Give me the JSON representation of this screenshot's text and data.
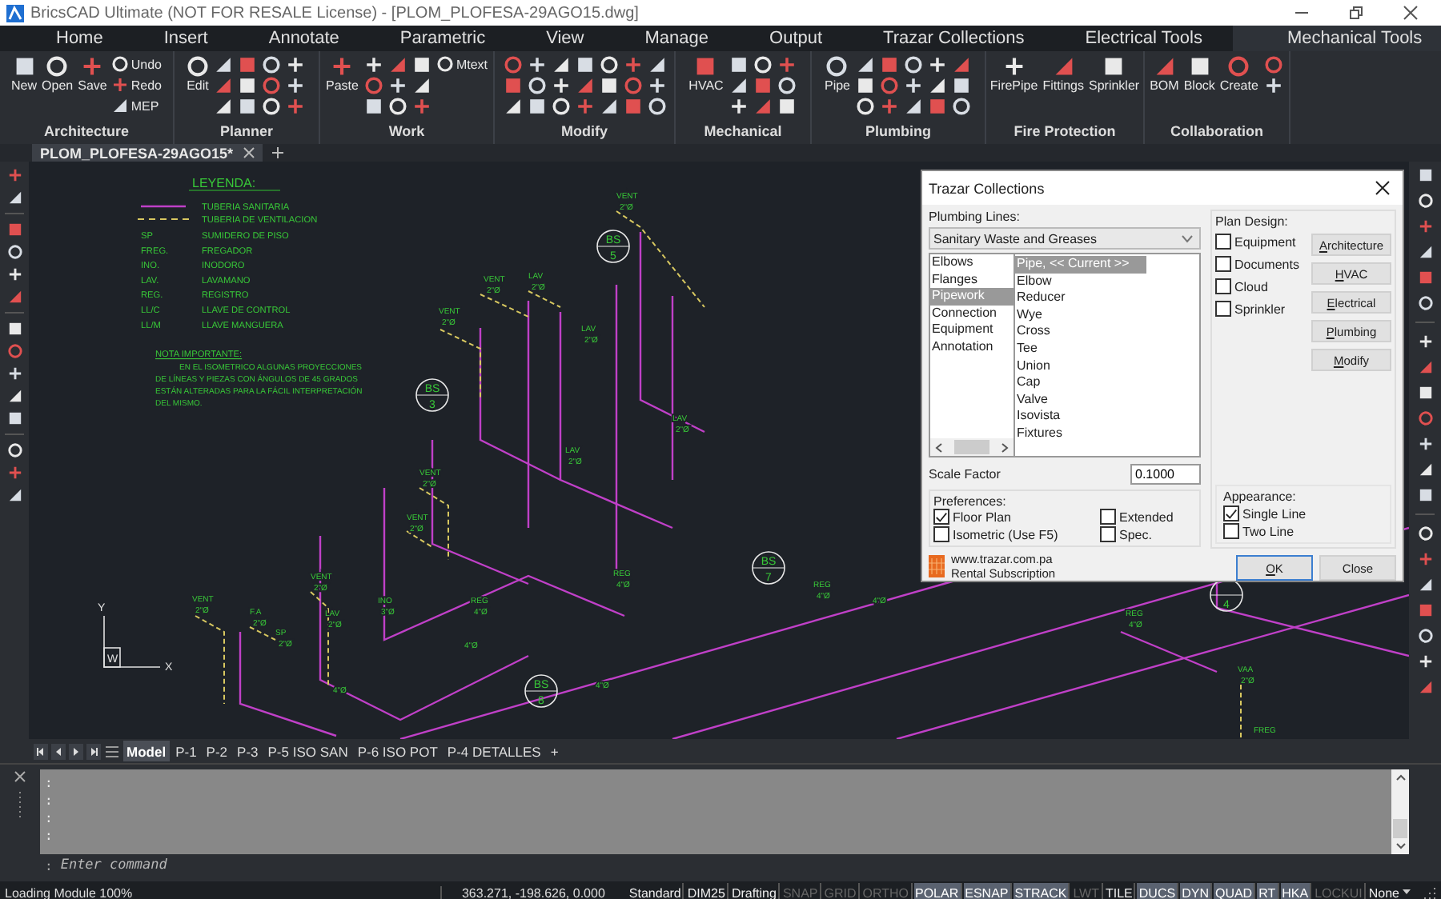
{
  "window": {
    "title": "BricsCAD Ultimate (NOT FOR RESALE License) - [PLOM_PLOFESA-29AGO15.dwg]"
  },
  "ribbon_tabs": [
    {
      "label": "Home",
      "selected": false
    },
    {
      "label": "Insert",
      "selected": false
    },
    {
      "label": "Annotate",
      "selected": false
    },
    {
      "label": "Parametric",
      "selected": false
    },
    {
      "label": "View",
      "selected": false
    },
    {
      "label": "Manage",
      "selected": false
    },
    {
      "label": "Output",
      "selected": false
    },
    {
      "label": "Trazar Collections",
      "selected": false
    },
    {
      "label": "Electrical Tools",
      "selected": false
    },
    {
      "label": "Mechanical Tools",
      "selected": true
    }
  ],
  "ribbon_panels": [
    {
      "title": "Architecture",
      "tools": [
        {
          "label": "New",
          "kind": "large"
        },
        {
          "label": "Open",
          "kind": "large"
        },
        {
          "label": "Save",
          "kind": "large"
        },
        {
          "label": "Undo",
          "kind": "small"
        },
        {
          "label": "Redo",
          "kind": "small"
        },
        {
          "label": "MEP",
          "kind": "small"
        }
      ]
    },
    {
      "title": "Planner",
      "tools": [
        {
          "label": "Edit",
          "kind": "large"
        }
      ]
    },
    {
      "title": "Work",
      "tools": [
        {
          "label": "Paste",
          "kind": "large"
        },
        {
          "label": "Mtext",
          "kind": "small"
        }
      ]
    },
    {
      "title": "Modify"
    },
    {
      "title": "Mechanical",
      "tools": [
        {
          "label": "HVAC",
          "kind": "large"
        }
      ]
    },
    {
      "title": "Plumbing",
      "tools": [
        {
          "label": "Pipe",
          "kind": "large"
        }
      ]
    },
    {
      "title": "Fire Protection",
      "tools": [
        {
          "label": "FirePipe",
          "kind": "large"
        },
        {
          "label": "Fittings",
          "kind": "large"
        },
        {
          "label": "Sprinkler",
          "kind": "large"
        }
      ]
    },
    {
      "title": "Collaboration",
      "tools": [
        {
          "label": "BOM",
          "kind": "large"
        },
        {
          "label": "Block",
          "kind": "large"
        },
        {
          "label": "Create",
          "kind": "large"
        }
      ]
    }
  ],
  "document_tab": {
    "label": "PLOM_PLOFESA-29AGO15*"
  },
  "legend": {
    "title": "LEYENDA:",
    "line_rows": [
      {
        "label": "TUBERIA SANITARIA",
        "kind": "solid"
      },
      {
        "label": "TUBERIA DE VENTILACION",
        "kind": "dashed"
      }
    ],
    "rows": [
      {
        "code": "SP",
        "label": "SUMIDERO DE PISO"
      },
      {
        "code": "FREG.",
        "label": "FREGADOR"
      },
      {
        "code": "INO.",
        "label": "INODORO"
      },
      {
        "code": "LAV.",
        "label": "LAVAMANO"
      },
      {
        "code": "REG.",
        "label": "REGISTRO"
      },
      {
        "code": "LL/C",
        "label": "LLAVE DE CONTROL"
      },
      {
        "code": "LL/M",
        "label": "LLAVE MANGUERA"
      }
    ],
    "note_title": "NOTA IMPORTANTE:",
    "note_lines": [
      "EN EL ISOMETRICO ALGUNAS PROYECCIONES",
      "DE LÍNEAS Y PIEZAS CON ÁNGULOS DE 45 GRADOS",
      "ESTÁN ALTERADAS PARA LA FÁCIL INTERPRETACIÓN",
      "DEL MISMO."
    ]
  },
  "drawing_labels": [
    {
      "text": "VENT",
      "sub": "2\"Ø"
    },
    {
      "text": "VENT",
      "sub": "2\"Ø"
    },
    {
      "text": "VENT",
      "sub": "2\"Ø"
    },
    {
      "text": "LAV",
      "sub": "2\"Ø"
    },
    {
      "text": "LAV",
      "sub": "2\"Ø"
    },
    {
      "text": "LAV",
      "sub": "2\"Ø"
    },
    {
      "text": "VENT",
      "sub": "2\"Ø"
    },
    {
      "text": "LAV",
      "sub": "2\"Ø"
    },
    {
      "text": "VENT",
      "sub": "2\"Ø"
    },
    {
      "text": "VENT",
      "sub": "2\"Ø"
    },
    {
      "text": "VENT",
      "sub": "2\"Ø"
    },
    {
      "text": "F.A",
      "sub": "2\"Ø"
    },
    {
      "text": "SP",
      "sub": "2\"Ø"
    },
    {
      "text": "LAV",
      "sub": "2\"Ø"
    },
    {
      "text": "INO",
      "sub": "3\"Ø"
    },
    {
      "text": "REG",
      "sub": "4\"Ø"
    },
    {
      "text": "REG",
      "sub": "4\"Ø"
    },
    {
      "text": "REG",
      "sub": "4\"Ø"
    },
    {
      "text": "4\"Ø"
    },
    {
      "text": "4\"Ø"
    },
    {
      "text": "4\"Ø"
    },
    {
      "text": "REG",
      "sub": "4\"Ø"
    },
    {
      "text": "VAA",
      "sub": "2\"Ø"
    },
    {
      "text": "FREG"
    },
    {
      "text": "4\"Ø"
    }
  ],
  "bs_markers": [
    {
      "top": "BS",
      "number": "5"
    },
    {
      "top": "BS",
      "number": "3"
    },
    {
      "top": "BS",
      "number": "7"
    },
    {
      "top": "BS",
      "number": "8"
    },
    {
      "number": "4"
    }
  ],
  "ucs": {
    "y": "Y",
    "x": "X",
    "w": "W"
  },
  "dialog": {
    "title": "Trazar Collections",
    "plumbing_lines_label": "Plumbing Lines:",
    "plumbing_type": "Sanitary Waste and Greases",
    "categories": [
      {
        "label": "Elbows",
        "selected": false
      },
      {
        "label": "Flanges",
        "selected": false
      },
      {
        "label": "Pipework",
        "selected": true
      },
      {
        "label": "Connection",
        "selected": false
      },
      {
        "label": "Equipment",
        "selected": false
      },
      {
        "label": "Annotation",
        "selected": false
      }
    ],
    "items": [
      {
        "label": "Pipe, << Current >>",
        "selected": true
      },
      {
        "label": "Elbow",
        "selected": false
      },
      {
        "label": "Reducer",
        "selected": false
      },
      {
        "label": "Wye",
        "selected": false
      },
      {
        "label": "Cross",
        "selected": false
      },
      {
        "label": "Tee",
        "selected": false
      },
      {
        "label": "Union",
        "selected": false
      },
      {
        "label": "Cap",
        "selected": false
      },
      {
        "label": "Valve",
        "selected": false
      },
      {
        "label": "Isovista",
        "selected": false
      },
      {
        "label": "Fixtures",
        "selected": false
      }
    ],
    "scale_factor_label": "Scale Factor",
    "scale_factor": "0.1000",
    "preferences_label": "Preferences:",
    "preferences": [
      {
        "label": "Floor Plan",
        "checked": true
      },
      {
        "label": "Extended",
        "checked": false
      },
      {
        "label": "Isometric (Use F5)",
        "checked": false
      },
      {
        "label": "Spec.",
        "checked": false
      }
    ],
    "website": "www.trazar.com.pa",
    "subscription": "Rental Subscription",
    "plan_design_label": "Plan Design:",
    "plan_design": [
      {
        "label": "Equipment",
        "checked": false
      },
      {
        "label": "Documents",
        "checked": false
      },
      {
        "label": "Cloud",
        "checked": false
      },
      {
        "label": "Sprinkler",
        "checked": false
      }
    ],
    "plan_buttons": [
      "Architecture",
      "HVAC",
      "Electrical",
      "Plumbing",
      "Modify"
    ],
    "appearance_label": "Appearance:",
    "appearance": [
      {
        "label": "Single Line",
        "checked": true
      },
      {
        "label": "Two Line",
        "checked": false
      }
    ],
    "buttons": [
      "OK",
      "Close"
    ]
  },
  "layout_tabs": [
    {
      "label": "Model",
      "selected": true
    },
    {
      "label": "P-1",
      "selected": false
    },
    {
      "label": "P-2",
      "selected": false
    },
    {
      "label": "P-3",
      "selected": false
    },
    {
      "label": "P-5 ISO SAN",
      "selected": false
    },
    {
      "label": "P-6 ISO POT",
      "selected": false
    },
    {
      "label": "P-4 DETALLES",
      "selected": false
    }
  ],
  "add_layout": "+",
  "command": {
    "history": [
      ":",
      ":",
      ":",
      ":"
    ],
    "prompt": ":",
    "placeholder": "Enter command"
  },
  "status_bar": {
    "message": "Loading Module 100%",
    "coordinates": "363.271, -198.626, 0.000",
    "items": [
      {
        "label": "Standard",
        "kind": "label"
      },
      {
        "label": "DIM25",
        "kind": "label"
      },
      {
        "label": "Drafting",
        "kind": "label"
      },
      {
        "label": "SNAP",
        "kind": "toggle",
        "on": false
      },
      {
        "label": "GRID",
        "kind": "toggle",
        "on": false
      },
      {
        "label": "ORTHO",
        "kind": "toggle",
        "on": false
      },
      {
        "label": "POLAR",
        "kind": "toggle",
        "on": true
      },
      {
        "label": "ESNAP",
        "kind": "toggle",
        "on": true
      },
      {
        "label": "STRACK",
        "kind": "toggle",
        "on": true
      },
      {
        "label": "LWT",
        "kind": "toggle",
        "on": false
      },
      {
        "label": "TILE",
        "kind": "label"
      },
      {
        "label": "DUCS",
        "kind": "toggle",
        "on": true
      },
      {
        "label": "DYN",
        "kind": "toggle",
        "on": true
      },
      {
        "label": "QUAD",
        "kind": "toggle",
        "on": true
      },
      {
        "label": "RT",
        "kind": "toggle",
        "on": true
      },
      {
        "label": "HKA",
        "kind": "toggle",
        "on": true
      },
      {
        "label": "LOCKUI",
        "kind": "toggle",
        "on": false
      },
      {
        "label": "None",
        "kind": "dropdown"
      }
    ]
  }
}
